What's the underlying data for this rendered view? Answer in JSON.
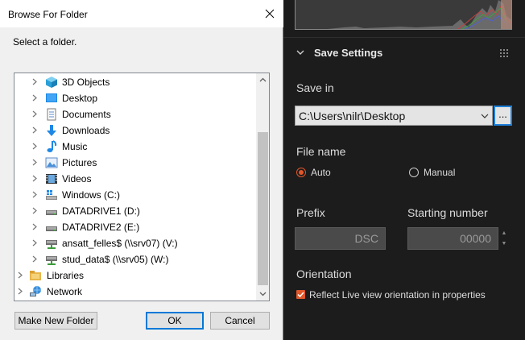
{
  "dialog": {
    "title": "Browse For Folder",
    "instruction": "Select a folder.",
    "tree": [
      {
        "label": "3D Objects",
        "icon": "3d-objects-icon"
      },
      {
        "label": "Desktop",
        "icon": "desktop-icon"
      },
      {
        "label": "Documents",
        "icon": "documents-icon"
      },
      {
        "label": "Downloads",
        "icon": "downloads-icon"
      },
      {
        "label": "Music",
        "icon": "music-icon"
      },
      {
        "label": "Pictures",
        "icon": "pictures-icon"
      },
      {
        "label": "Videos",
        "icon": "videos-icon"
      },
      {
        "label": "Windows  (C:)",
        "icon": "windows-drive-icon"
      },
      {
        "label": "DATADRIVE1 (D:)",
        "icon": "drive-icon"
      },
      {
        "label": "DATADRIVE2 (E:)",
        "icon": "drive-icon"
      },
      {
        "label": "ansatt_felles$ (\\\\srv07) (V:)",
        "icon": "network-drive-icon"
      },
      {
        "label": "stud_data$ (\\\\srv05) (W:)",
        "icon": "network-drive-icon"
      },
      {
        "label": "Libraries",
        "icon": "libraries-icon"
      },
      {
        "label": "Network",
        "icon": "network-icon"
      }
    ],
    "buttons": {
      "make_new_folder": "Make New Folder",
      "ok": "OK",
      "cancel": "Cancel"
    }
  },
  "settings": {
    "section_title": "Save Settings",
    "save_in_label": "Save in",
    "save_in_value": "C:\\Users\\nilr\\Desktop",
    "browse_label": "...",
    "file_name_label": "File name",
    "auto_label": "Auto",
    "manual_label": "Manual",
    "selected_option": "Auto",
    "prefix_label": "Prefix",
    "prefix_value": "DSC",
    "starting_number_label": "Starting number",
    "starting_number_value": "00000",
    "orientation_label": "Orientation",
    "orientation_checkbox_label": "Reflect Live view orientation in properties",
    "orientation_checked": true
  },
  "colors": {
    "accent": "#e0572a",
    "focus_blue": "#0078d7",
    "panel_bg": "#1c1c1c"
  }
}
